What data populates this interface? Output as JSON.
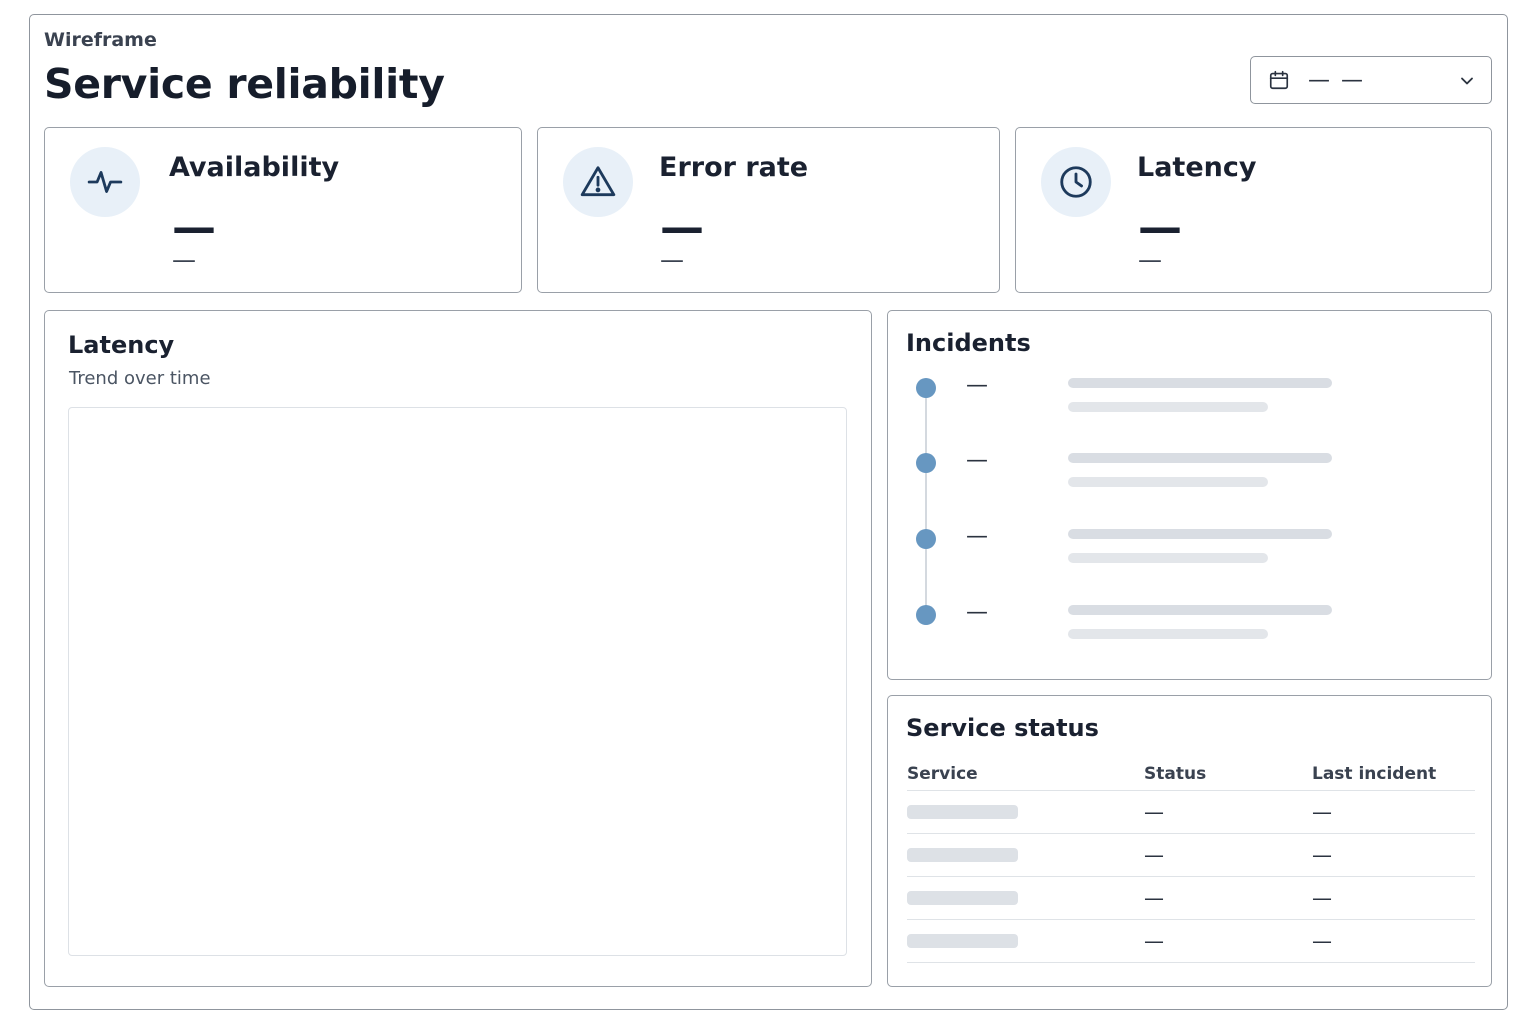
{
  "header": {
    "wireframe_label": "Wireframe",
    "title": "Service reliability",
    "date_range": "— —"
  },
  "kpis": [
    {
      "title": "Availability",
      "value": "—",
      "sub": "—",
      "icon": "pulse-icon"
    },
    {
      "title": "Error rate",
      "value": "—",
      "sub": "—",
      "icon": "warning-icon"
    },
    {
      "title": "Latency",
      "value": "—",
      "sub": "—",
      "icon": "clock-icon"
    }
  ],
  "latency_panel": {
    "title": "Latency",
    "subtitle": "Trend over time"
  },
  "incidents": {
    "title": "Incidents",
    "items": [
      {
        "time": "—"
      },
      {
        "time": "—"
      },
      {
        "time": "—"
      },
      {
        "time": "—"
      }
    ]
  },
  "service_status": {
    "title": "Service status",
    "columns": [
      "Service",
      "Status",
      "Last incident"
    ],
    "rows": [
      {
        "status": "—",
        "last_incident": "—"
      },
      {
        "status": "—",
        "last_incident": "—"
      },
      {
        "status": "—",
        "last_incident": "—"
      },
      {
        "status": "—",
        "last_incident": "—"
      }
    ]
  },
  "colors": {
    "accent_dot": "#6797c1",
    "icon_bg": "#e8f0f8",
    "icon_stroke": "#1d3a5c",
    "border": "#9aa0a8"
  }
}
